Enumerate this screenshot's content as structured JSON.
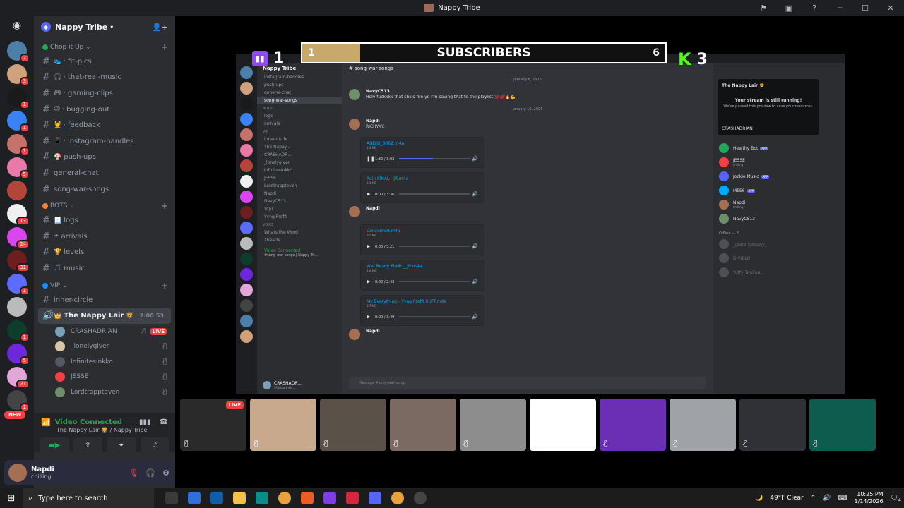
{
  "window": {
    "title": "Nappy Tribe"
  },
  "guild": {
    "name": "Nappy Tribe"
  },
  "categories": {
    "chop": "Chop it Up",
    "bots": "BOTS",
    "vip": "VIP"
  },
  "channels_chop": [
    {
      "label": "fit-pics",
      "emoji": "👟 ·"
    },
    {
      "label": "that-real-music",
      "emoji": "🎧 ·"
    },
    {
      "label": "gaming-clips",
      "emoji": "🎮 ·"
    },
    {
      "label": "bugging-out",
      "emoji": "😡 ·"
    },
    {
      "label": "feedback",
      "emoji": "💆 ·"
    },
    {
      "label": "instagram-handles",
      "emoji": "📱 ·"
    },
    {
      "label": "push-ups",
      "emoji": "🍄"
    },
    {
      "label": "general-chat",
      "emoji": ""
    },
    {
      "label": "song-war-songs",
      "emoji": ""
    }
  ],
  "channels_bots": [
    {
      "label": "logs",
      "emoji": "📃"
    },
    {
      "label": "arrivals",
      "emoji": "✈"
    },
    {
      "label": "levels",
      "emoji": "🏆"
    },
    {
      "label": "music",
      "emoji": "🎵"
    }
  ],
  "channels_vip": [
    {
      "label": "inner-circle",
      "emoji": ""
    }
  ],
  "voice_channel": {
    "label": "The Nappy Lair",
    "emoji": "👑",
    "emoji2": "🦁",
    "timer": "2:00:53"
  },
  "voice_users": [
    {
      "name": "CRASHADRIAN",
      "live": "LIVE",
      "color": "#7aa0b8"
    },
    {
      "name": "_lonelygiver",
      "live": "",
      "color": "#d9c7a8"
    },
    {
      "name": "Infinitesinkko",
      "live": "",
      "color": "#555a60"
    },
    {
      "name": "JESSE",
      "live": "",
      "color": "#f23f43"
    },
    {
      "name": "Lordtrapptoven",
      "live": "",
      "color": "#6e8f6a"
    }
  ],
  "voice_panel": {
    "status": "Video Connected",
    "location": "The Nappy Lair 🦁 / Nappy Tribe"
  },
  "user": {
    "name": "Napdi",
    "status": "chilling"
  },
  "overlay": {
    "twitch_count": "1",
    "bar_left": "1",
    "bar_title": "SUBSCRIBERS",
    "bar_right": "6",
    "kick_count": "3",
    "progress": 0.16
  },
  "inner": {
    "title": "Nappy Tribe",
    "guild": "Nappy Tribe",
    "channel": "song-war-songs",
    "channels": [
      "instagram-handles",
      "push-ups",
      "general-chat",
      "song-war-songs",
      "BOTS",
      "logs",
      "arrivals",
      "VIP",
      "inner-circle",
      "The Nappy...",
      "CRASHADR...",
      "_lonelygiver",
      "Infinitesinkko",
      "JESSE",
      "Lordtrapptoven",
      "Napdi",
      "NavyC513",
      "Top!",
      "Yvng Profit",
      "VOICE",
      "Whats the Word",
      "Theatre"
    ],
    "voice_status": "Video Connected",
    "voice_channel_label": "#song-war-songs | Nappy Tri...",
    "user": "CRASHADR...",
    "user_status": "Sharing their...",
    "date1": "January 6, 2026",
    "date2": "January 15, 2026",
    "msg1_name": "NavyC513",
    "msg1_text": "Holy fuckkkk that shiiis fire yo I'm saving that to the playlist 💯💯🔥💪",
    "msg2_name": "Napdi",
    "msg2_text": "RICHYYY:",
    "attachments": [
      {
        "file": "AUDIO_0002.m4a",
        "size": "1.4 MB",
        "time": "1:30 / 3:03",
        "progress": 0.48,
        "paused": "❚❚"
      },
      {
        "file": "Rain FINAL__JR.m4a",
        "size": "3.3 MB",
        "time": "0:00 / 3:36",
        "progress": 0,
        "paused": "▶"
      }
    ],
    "msg3_name": "Napdi",
    "attachments2": [
      {
        "file": "Concerned.m4a",
        "size": "3.5 MB",
        "time": "0:00 / 3:21",
        "progress": 0,
        "paused": "▶"
      },
      {
        "file": "War Ready FINAL__JR.m4a",
        "size": "3.4 MB",
        "time": "0:00 / 2:43",
        "progress": 0,
        "paused": "▶"
      },
      {
        "file": "My Everything - Yvng Profit RUFF.m4a",
        "size": "3.7 MB",
        "time": "0:00 / 3:49",
        "progress": 0,
        "paused": "▶"
      }
    ],
    "msg4_name": "Napdi",
    "input_placeholder": "Message #song-war-songs",
    "popup_title": "The Nappy Lair 🦁",
    "popup_body": "Your stream is still running!",
    "popup_sub": "We've paused this preview to save your resources.",
    "popup_user": "CRASHADRIAN",
    "members": [
      {
        "name": "Healthy Bot",
        "tag": "APP",
        "status": "",
        "color": "#23a55a"
      },
      {
        "name": "JESSE",
        "tag": "",
        "status": "chilling",
        "color": "#f23f43"
      },
      {
        "name": "Jockie Music",
        "tag": "APP",
        "status": "",
        "color": "#5865f2"
      },
      {
        "name": "MEE6",
        "tag": "APP",
        "status": "",
        "color": "#00a8fc"
      },
      {
        "name": "Napdi",
        "tag": "",
        "status": "chilling",
        "color": "#a56f53"
      },
      {
        "name": "NavyC513",
        "tag": "",
        "status": "",
        "color": "#6e8f6a"
      }
    ],
    "offline_header": "Offline — 3",
    "offline": [
      "_grannypusssy_",
      "DIVIBLO",
      "Yuffy TwoFour"
    ]
  },
  "tiles": [
    {
      "color": "#2a2a2a",
      "live": "LIVE"
    },
    {
      "color": "#c9a98e",
      "live": ""
    },
    {
      "color": "#5a5148",
      "live": ""
    },
    {
      "color": "#7a6a62",
      "live": ""
    },
    {
      "color": "#8d8d8d",
      "live": ""
    },
    {
      "color": "#ffffff",
      "live": ""
    },
    {
      "color": "#6a2fb5",
      "live": ""
    },
    {
      "color": "#9fa3a8",
      "live": ""
    },
    {
      "color": "#2f3136",
      "live": ""
    },
    {
      "color": "#0e5c4e",
      "live": ""
    }
  ],
  "taskbar": {
    "search_placeholder": "Type here to search",
    "weather": "49°F  Clear",
    "time": "10:25 PM",
    "date": "1/14/2026",
    "notif": "4"
  },
  "server_badges": [
    "2",
    "3",
    "1",
    "1",
    "1",
    "5",
    "",
    "13",
    "24",
    "31",
    "1",
    "",
    "1",
    "5",
    "21",
    "1"
  ]
}
